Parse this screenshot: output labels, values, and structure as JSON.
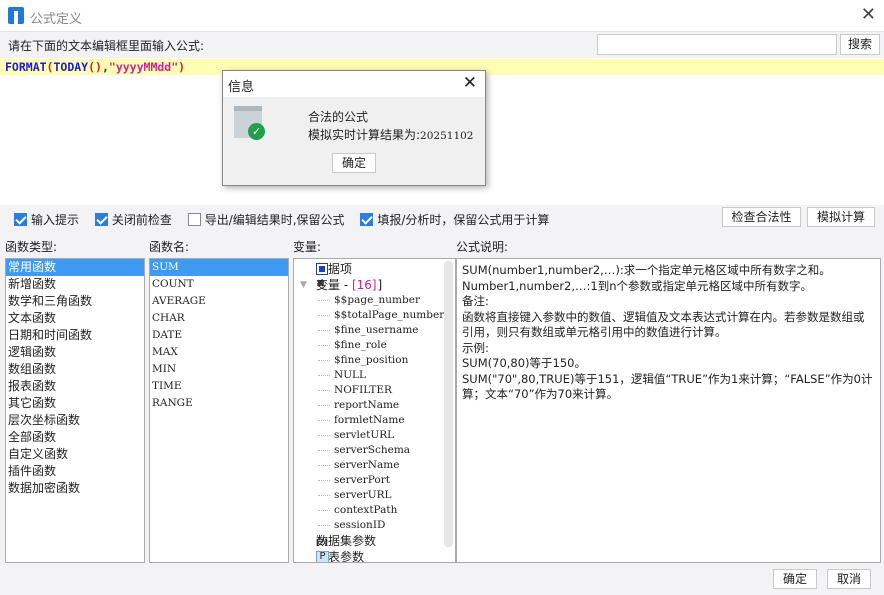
{
  "window": {
    "title": "公式定义"
  },
  "prompt": "请在下面的文本编辑框里面输入公式:",
  "search": {
    "placeholder": "",
    "button": "搜索"
  },
  "formula": {
    "fn1": "FORMAT",
    "p1": "(",
    "fn2": "TODAY",
    "p2": "()",
    "comma": ",",
    "str": "\"yyyyMMdd\"",
    "p3": ")"
  },
  "dialog": {
    "title": "信息",
    "line1": "合法的公式",
    "line2": "模拟实时计算结果为:",
    "result": "20251102",
    "ok": "确定"
  },
  "options": [
    {
      "label": "输入提示",
      "checked": true
    },
    {
      "label": "关闭前检查",
      "checked": true
    },
    {
      "label": "导出/编辑结果时,保留公式",
      "checked": false
    },
    {
      "label": "填报/分析时，保留公式用于计算",
      "checked": true
    }
  ],
  "actions": {
    "check": "检查合法性",
    "simulate": "模拟计算"
  },
  "labels": {
    "types": "函数类型:",
    "names": "函数名:",
    "vars": "变量:",
    "desc": "公式说明:"
  },
  "function_types": [
    "常用函数",
    "新增函数",
    "数学和三角函数",
    "文本函数",
    "日期和时间函数",
    "逻辑函数",
    "数组函数",
    "报表函数",
    "其它函数",
    "层次坐标函数",
    "全部函数",
    "自定义函数",
    "插件函数",
    "数据加密函数"
  ],
  "function_names": [
    "SUM",
    "COUNT",
    "AVERAGE",
    "CHAR",
    "DATE",
    "MAX",
    "MIN",
    "TIME",
    "RANGE"
  ],
  "variables": {
    "data_items": "数据项",
    "var_group": "变量 - ",
    "var_count": "[16]",
    "items": [
      "$$page_number",
      "$$totalPage_number",
      "$fine_username",
      "$fine_role",
      "$fine_position",
      "NULL",
      "NOFILTER",
      "reportName",
      "formletName",
      "servletURL",
      "serverSchema",
      "serverName",
      "serverPort",
      "serverURL",
      "contextPath",
      "sessionID"
    ],
    "dataset_params": "数据集参数",
    "report_params": "报表参数"
  },
  "description": [
    "SUM(number1,number2,…):求一个指定单元格区域中所有数字之和。",
    "Number1,number2,…:1到n个参数或指定单元格区域中所有数字。",
    "备注:",
    "函数将直接键入参数中的数值、逻辑值及文本表达式计算在内。若参数是数组或引用，则只有数组或单元格引用中的数值进行计算。",
    "示例:",
    "SUM(70,80)等于150。",
    "SUM(\"70\",80,TRUE)等于151，逻辑值“TRUE”作为1来计算；“FALSE”作为0计算；文本“70”作为70来计算。"
  ],
  "footer": {
    "ok": "确定",
    "cancel": "取消"
  },
  "colors": {
    "selection": "#3f9bf2",
    "highlight": "#ffffb3",
    "accent": "#2b7ee0"
  }
}
